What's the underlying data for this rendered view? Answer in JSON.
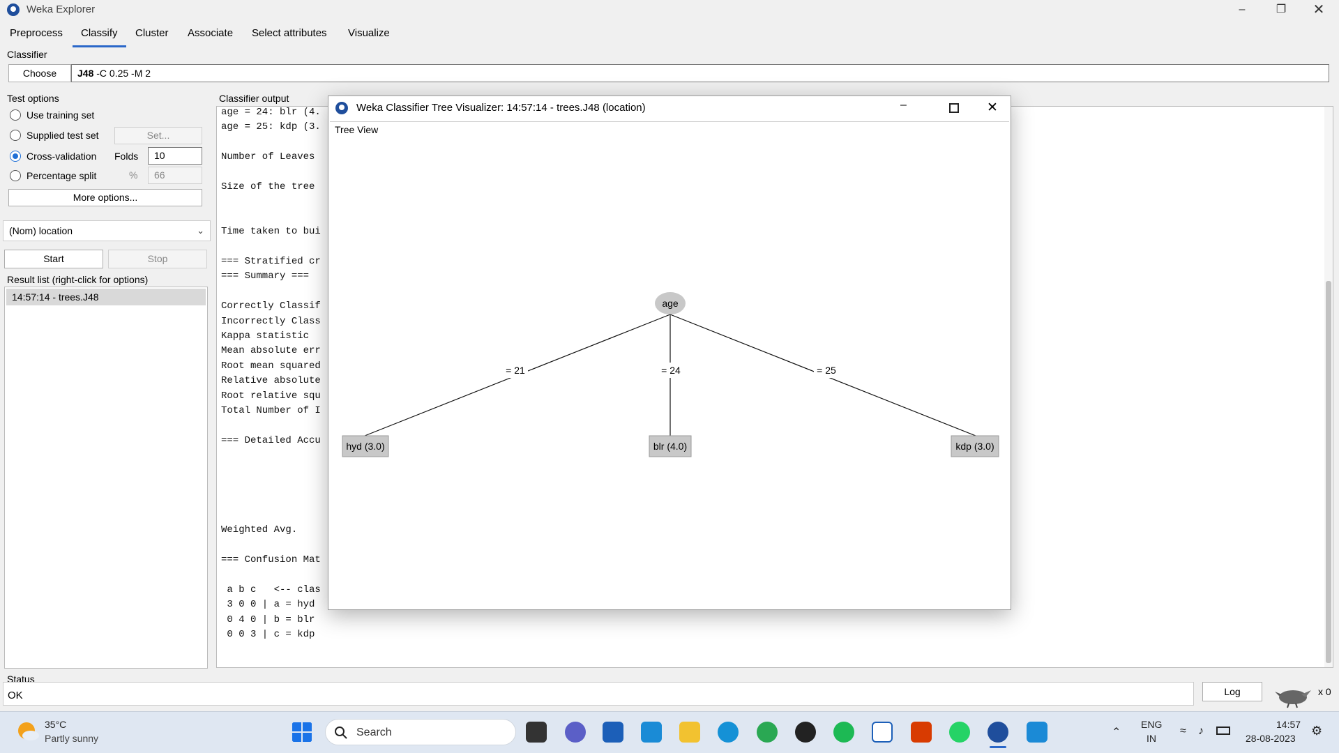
{
  "window": {
    "title": "Weka Explorer"
  },
  "tabs": [
    "Preprocess",
    "Classify",
    "Cluster",
    "Associate",
    "Select attributes",
    "Visualize"
  ],
  "classifier": {
    "group_label": "Classifier",
    "choose_label": "Choose",
    "name": "J48",
    "options": " -C 0.25 -M 2"
  },
  "test_options": {
    "group_label": "Test options",
    "use_training": "Use training set",
    "supplied": "Supplied test set",
    "set_label": "Set...",
    "cross_validation": "Cross-validation",
    "folds_label": "Folds",
    "folds_value": "10",
    "percentage_split": "Percentage split",
    "percent_symbol": "%",
    "percent_value": "66",
    "more_options": "More options..."
  },
  "class_attribute": "(Nom) location",
  "start_label": "Start",
  "stop_label": "Stop",
  "result_list": {
    "label": "Result list (right-click for options)",
    "items": [
      "14:57:14 - trees.J48"
    ]
  },
  "output": {
    "label": "Classifier output",
    "lines": [
      "age = 24: blr (4.",
      "age = 25: kdp (3.",
      "",
      "Number of Leaves",
      "",
      "Size of the tree",
      "",
      "",
      "Time taken to bui",
      "",
      "=== Stratified cr",
      "=== Summary ===",
      "",
      "Correctly Classif",
      "Incorrectly Class",
      "Kappa statistic",
      "Mean absolute err",
      "Root mean squared",
      "Relative absolute",
      "Root relative squ",
      "Total Number of I",
      "",
      "=== Detailed Accu",
      "",
      "",
      "",
      "",
      "",
      "Weighted Avg.",
      "",
      "=== Confusion Mat",
      "",
      " a b c   <-- clas",
      " 3 0 0 | a = hyd",
      " 0 4 0 | b = blr",
      " 0 0 3 | c = kdp"
    ]
  },
  "viz": {
    "title": "Weka Classifier Tree Visualizer: 14:57:14 - trees.J48 (location)",
    "panel_label": "Tree View",
    "root": "age",
    "edges": [
      "= 21",
      "= 24",
      "= 25"
    ],
    "leaves": [
      "hyd (3.0)",
      "blr (4.0)",
      "kdp (3.0)"
    ]
  },
  "status": {
    "label": "Status",
    "text": "OK",
    "log_label": "Log",
    "count": "x 0"
  },
  "taskbar": {
    "weather_temp": "35°C",
    "weather_desc": "Partly sunny",
    "search_label": "Search",
    "lang": "ENG",
    "region": "IN",
    "time": "14:57",
    "date": "28-08-2023",
    "icons": [
      "windows-start",
      "file-manager",
      "meet",
      "store",
      "myhp",
      "explorer",
      "edge",
      "chrome",
      "media-player",
      "spotify",
      "window-app",
      "office",
      "whatsapp",
      "weka",
      "notepad"
    ]
  }
}
